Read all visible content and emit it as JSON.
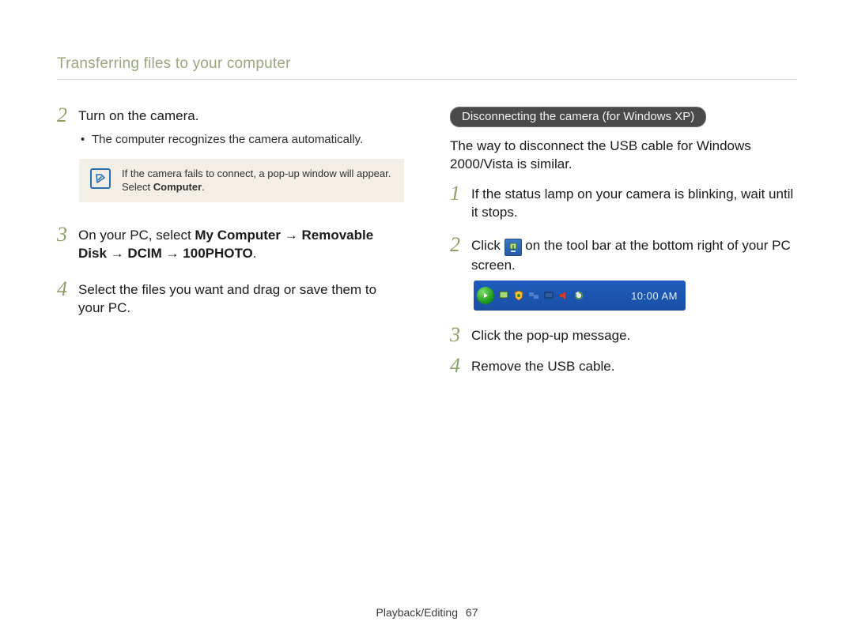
{
  "header": {
    "title": "Transferring files to your computer"
  },
  "left": {
    "step2": {
      "num": "2",
      "text": "Turn on the camera."
    },
    "bullet": "The computer recognizes the camera automatically.",
    "note": {
      "icon_label": "note",
      "text_prefix": "If the camera fails to connect, a pop-up window will appear. Select ",
      "text_bold": "Computer",
      "text_suffix": "."
    },
    "step3": {
      "num": "3",
      "pre": "On your PC, select ",
      "b1": "My Computer",
      "arrow1": " → ",
      "b2": "Removable Disk",
      "arrow2": " → ",
      "b3": "DCIM",
      "arrow3": " → ",
      "b4": "100PHOTO",
      "tail": "."
    },
    "step4": {
      "num": "4",
      "text": "Select the files you want and drag or save them to your PC."
    }
  },
  "right": {
    "pill": "Disconnecting the camera (for Windows XP)",
    "intro": "The way to disconnect the USB cable for Windows 2000/Vista is similar.",
    "step1": {
      "num": "1",
      "text": "If the status lamp on your camera is blinking, wait until it stops."
    },
    "step2": {
      "num": "2",
      "pre": "Click ",
      "post": " on the tool bar at the bottom right of your PC screen."
    },
    "taskbar": {
      "time": "10:00 AM",
      "icons": [
        "start",
        "safely-remove",
        "shield",
        "network",
        "monitor",
        "volume",
        "updates"
      ]
    },
    "step3": {
      "num": "3",
      "text": "Click the pop-up message."
    },
    "step4": {
      "num": "4",
      "text": "Remove the USB cable."
    }
  },
  "footer": {
    "section": "Playback/Editing",
    "page": "67"
  }
}
